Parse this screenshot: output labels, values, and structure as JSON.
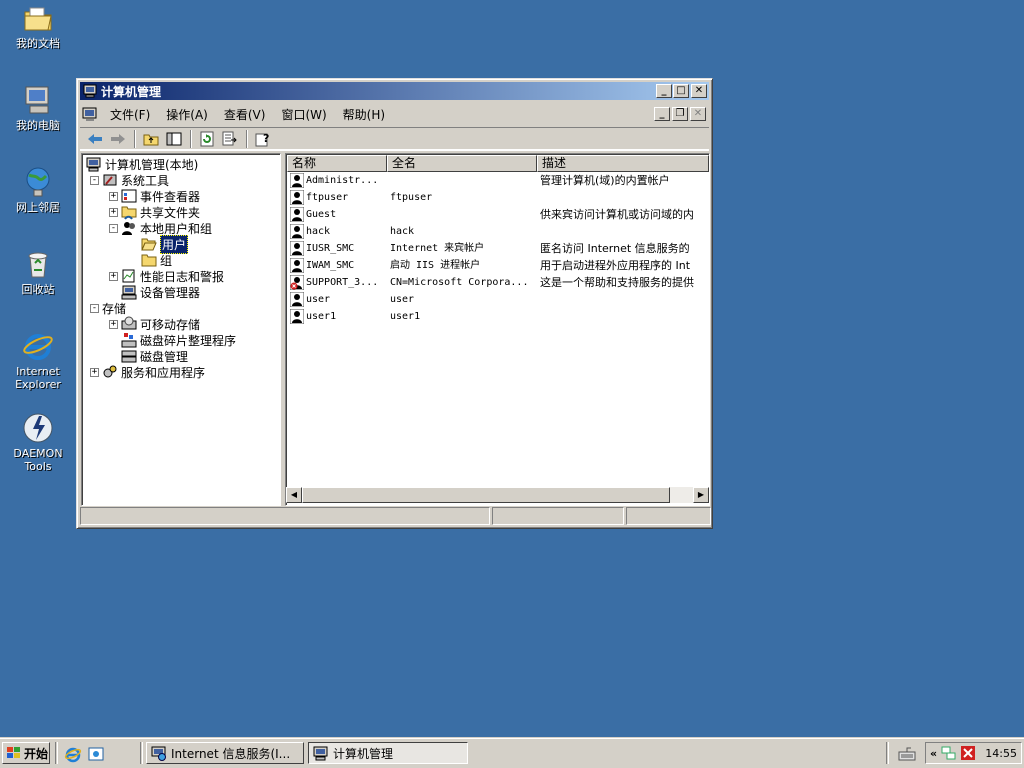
{
  "desktop": {
    "icons": [
      {
        "label": "我的文档",
        "icon": "my-documents-icon"
      },
      {
        "label": "我的电脑",
        "icon": "my-computer-icon"
      },
      {
        "label": "网上邻居",
        "icon": "network-places-icon"
      },
      {
        "label": "回收站",
        "icon": "recycle-bin-icon"
      },
      {
        "label1": "Internet",
        "label2": "Explorer",
        "icon": "internet-explorer-icon"
      },
      {
        "label": "DAEMON Tools",
        "icon": "daemon-tools-icon"
      }
    ],
    "background_color": "#3a6ea5"
  },
  "window": {
    "title": "计算机管理",
    "menu": [
      "文件(F)",
      "操作(A)",
      "查看(V)",
      "窗口(W)",
      "帮助(H)"
    ],
    "tree": [
      {
        "label": "计算机管理(本地)",
        "level": 0
      },
      {
        "label": "系统工具",
        "level": 1,
        "expander": "-"
      },
      {
        "label": "事件查看器",
        "level": 2,
        "expander": "+"
      },
      {
        "label": "共享文件夹",
        "level": 2,
        "expander": "+"
      },
      {
        "label": "本地用户和组",
        "level": 2,
        "expander": "-"
      },
      {
        "label": "用户",
        "level": 3,
        "selected": true
      },
      {
        "label": "组",
        "level": 3
      },
      {
        "label": "性能日志和警报",
        "level": 2,
        "expander": "+"
      },
      {
        "label": "设备管理器",
        "level": 2
      },
      {
        "label": "存储",
        "level": 1,
        "expander": "-"
      },
      {
        "label": "可移动存储",
        "level": 2,
        "expander": "+"
      },
      {
        "label": "磁盘碎片整理程序",
        "level": 2
      },
      {
        "label": "磁盘管理",
        "level": 2
      },
      {
        "label": "服务和应用程序",
        "level": 1,
        "expander": "+"
      }
    ],
    "columns": [
      "名称",
      "全名",
      "描述"
    ],
    "users": [
      {
        "name": "Administr...",
        "fullname": "",
        "description": "管理计算机(域)的内置帐户",
        "disabled": false
      },
      {
        "name": "ftpuser",
        "fullname": "ftpuser",
        "description": "",
        "disabled": false
      },
      {
        "name": "Guest",
        "fullname": "",
        "description": "供来宾访问计算机或访问域的内",
        "disabled": false
      },
      {
        "name": "hack",
        "fullname": "hack",
        "description": "",
        "disabled": false
      },
      {
        "name": "IUSR_SMC",
        "fullname": "Internet 来宾帐户",
        "description": "匿名访问 Internet 信息服务的",
        "disabled": false
      },
      {
        "name": "IWAM_SMC",
        "fullname": "启动 IIS 进程帐户",
        "description": "用于启动进程外应用程序的 Int",
        "disabled": false
      },
      {
        "name": "SUPPORT_3...",
        "fullname": "CN=Microsoft Corpora...",
        "description": "这是一个帮助和支持服务的提供",
        "disabled": true
      },
      {
        "name": "user",
        "fullname": "user",
        "description": "",
        "disabled": false
      },
      {
        "name": "user1",
        "fullname": "user1",
        "description": "",
        "disabled": false
      }
    ]
  },
  "taskbar": {
    "start_label": "开始",
    "tasks": [
      {
        "label": "Internet 信息服务(I...",
        "active": false
      },
      {
        "label": "计算机管理",
        "active": true
      }
    ],
    "clock": "14:55",
    "tray_chevron": "«"
  }
}
